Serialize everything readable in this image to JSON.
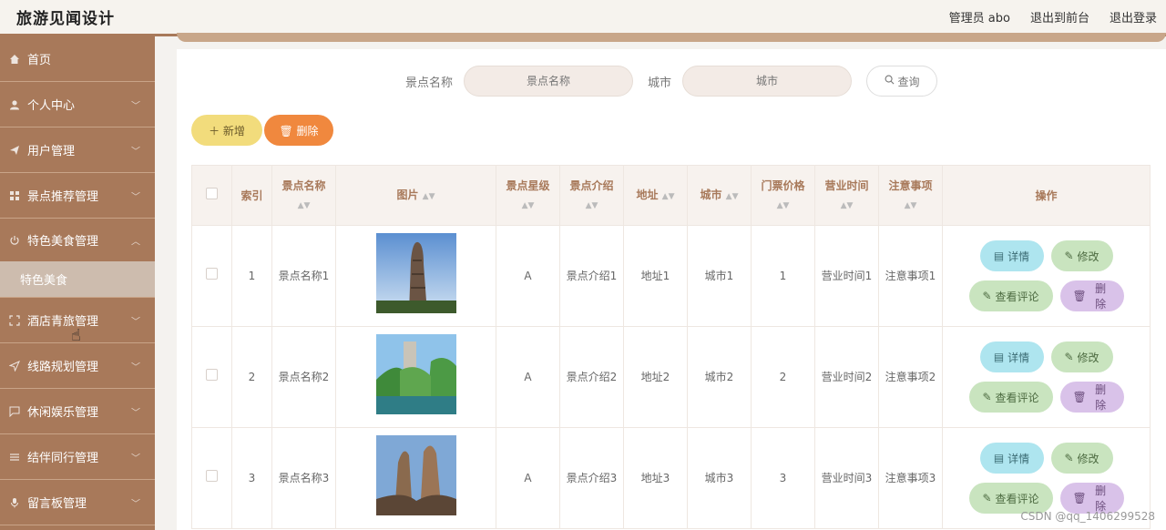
{
  "header": {
    "title": "旅游见闻设计",
    "admin": "管理员 abo",
    "to_front": "退出到前台",
    "logout": "退出登录"
  },
  "sidebar": {
    "items": [
      {
        "label": "首页",
        "icon": "home-icon"
      },
      {
        "label": "个人中心",
        "icon": "user-icon"
      },
      {
        "label": "用户管理",
        "icon": "send-icon"
      },
      {
        "label": "景点推荐管理",
        "icon": "grid-icon"
      },
      {
        "label": "特色美食管理",
        "icon": "power-icon"
      },
      {
        "label": "酒店青旅管理",
        "icon": "frame-icon"
      },
      {
        "label": "线路规划管理",
        "icon": "navigation-icon"
      },
      {
        "label": "休闲娱乐管理",
        "icon": "message-icon"
      },
      {
        "label": "结伴同行管理",
        "icon": "list-icon"
      },
      {
        "label": "留言板管理",
        "icon": "mic-icon"
      }
    ],
    "submenu": {
      "label": "特色美食"
    }
  },
  "search": {
    "name_label": "景点名称",
    "name_placeholder": "景点名称",
    "city_label": "城市",
    "city_placeholder": "城市",
    "button": "查询"
  },
  "actions": {
    "add": "新增",
    "delete": "删除"
  },
  "table": {
    "headers": [
      "索引",
      "景点名称",
      "图片",
      "景点星级",
      "景点介绍",
      "地址",
      "城市",
      "门票价格",
      "营业时间",
      "注意事项",
      "操作"
    ],
    "rows": [
      {
        "index": "1",
        "name": "景点名称1",
        "star": "A",
        "intro": "景点介绍1",
        "address": "地址1",
        "city": "城市1",
        "price": "1",
        "hours": "营业时间1",
        "notes": "注意事项1"
      },
      {
        "index": "2",
        "name": "景点名称2",
        "star": "A",
        "intro": "景点介绍2",
        "address": "地址2",
        "city": "城市2",
        "price": "2",
        "hours": "营业时间2",
        "notes": "注意事项2"
      },
      {
        "index": "3",
        "name": "景点名称3",
        "star": "A",
        "intro": "景点介绍3",
        "address": "地址3",
        "city": "城市3",
        "price": "3",
        "hours": "营业时间3",
        "notes": "注意事项3"
      }
    ],
    "ops": {
      "detail": "详情",
      "edit": "修改",
      "comment": "查看评论",
      "delete": "删除"
    }
  },
  "watermark": "CSDN @qq_1406299528",
  "colors": {
    "brand": "#a8795a",
    "add": "#f2dc7c",
    "delete": "#f0883e"
  }
}
